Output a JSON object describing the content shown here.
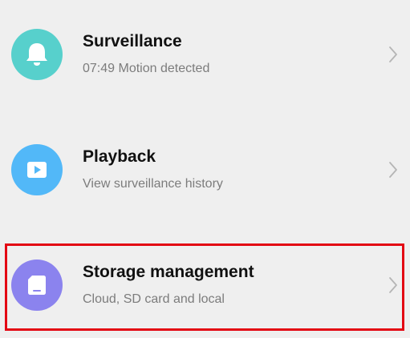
{
  "menu": {
    "items": [
      {
        "title": "Surveillance",
        "subtitle": "07:49 Motion detected",
        "icon": "bell-icon",
        "icon_color": "#57d0cc"
      },
      {
        "title": "Playback",
        "subtitle": "View surveillance history",
        "icon": "play-icon",
        "icon_color": "#52b8f8"
      },
      {
        "title": "Storage management",
        "subtitle": "Cloud, SD card and local",
        "icon": "sd-card-icon",
        "icon_color": "#8b83ee"
      }
    ],
    "chevron_icon": "chevron-right-icon",
    "highlighted_item": "Storage management",
    "highlight_color": "#e30613"
  }
}
